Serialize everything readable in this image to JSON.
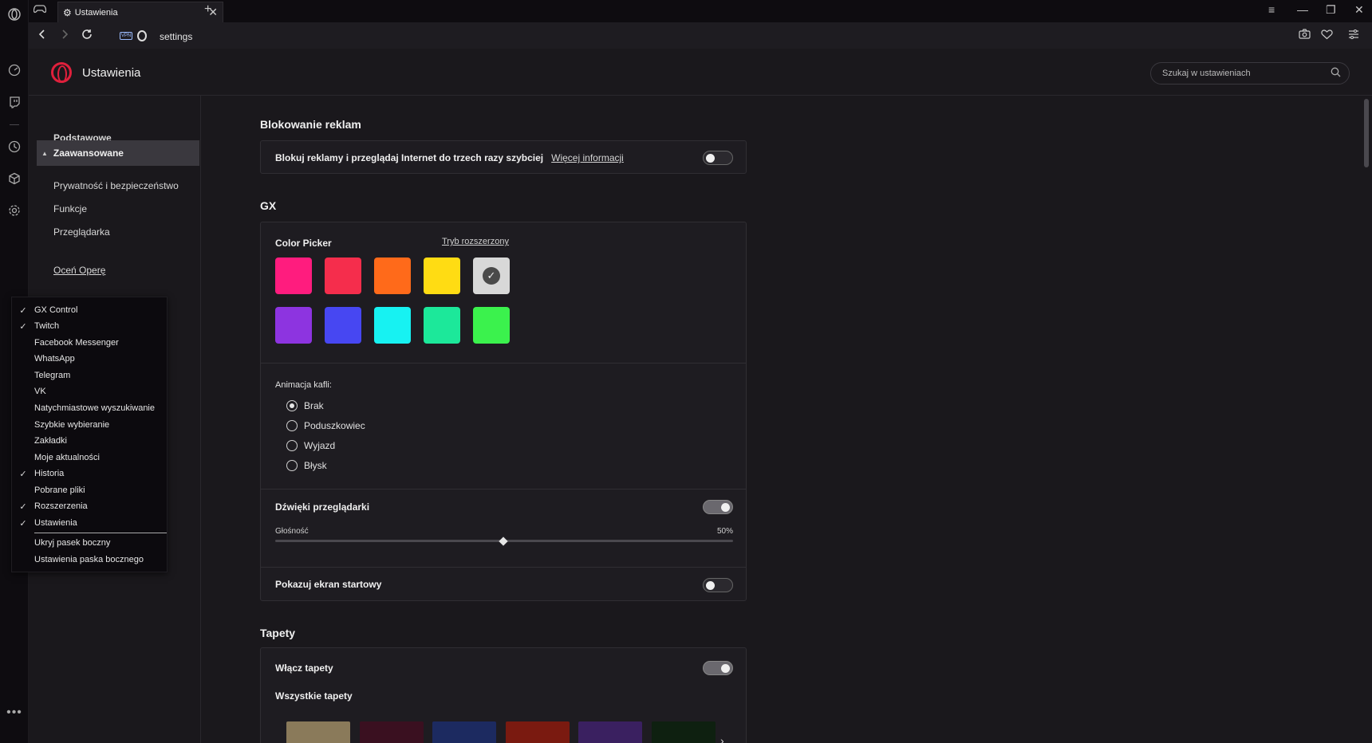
{
  "tab": {
    "title": "Ustawienia"
  },
  "address": {
    "url": "settings"
  },
  "header": {
    "title": "Ustawienia",
    "search_placeholder": "Szukaj w ustawieniach"
  },
  "nav": {
    "basic": "Podstawowe",
    "advanced": "Zaawansowane",
    "privacy": "Prywatność i bezpieczeństwo",
    "features": "Funkcje",
    "browser": "Przeglądarka",
    "rate": "Oceń Operę"
  },
  "adblock": {
    "title": "Blokowanie reklam",
    "label": "Blokuj reklamy i przeglądaj Internet do trzech razy szybciej",
    "link": "Więcej informacji",
    "enabled": false
  },
  "gx": {
    "title": "GX",
    "color_picker": "Color Picker",
    "extended_mode": "Tryb rozszerzony",
    "colors": [
      "#ff1c7e",
      "#f52d4c",
      "#ff6a1a",
      "#ffdc13",
      "#d8d8d8",
      "#8d34e0",
      "#4747f2",
      "#17f2f2",
      "#1ce89a",
      "#3bf24d"
    ],
    "selected_color_index": 4,
    "tile_anim_label": "Animacja kafli:",
    "tile_anim_options": [
      "Brak",
      "Poduszkowiec",
      "Wyjazd",
      "Błysk"
    ],
    "tile_anim_selected": 0,
    "sounds_label": "Dźwięki przeglądarki",
    "sounds_enabled": true,
    "volume_label": "Głośność",
    "volume_value": "50%",
    "startup_label": "Pokazuj ekran startowy",
    "startup_enabled": false
  },
  "wallpapers": {
    "title": "Tapety",
    "enable_label": "Włącz tapety",
    "enabled": true,
    "all_label": "Wszystkie tapety",
    "thumb_colors": [
      "#8a7a5a",
      "#3a1020",
      "#1c2a60",
      "#7a1a10",
      "#3a2060",
      "#0e2010"
    ]
  },
  "context_menu": {
    "items": [
      {
        "label": "GX Control",
        "checked": true
      },
      {
        "label": "Twitch",
        "checked": true
      },
      {
        "label": "Facebook Messenger",
        "checked": false
      },
      {
        "label": "WhatsApp",
        "checked": false
      },
      {
        "label": "Telegram",
        "checked": false
      },
      {
        "label": "VK",
        "checked": false
      },
      {
        "label": "Natychmiastowe wyszukiwanie",
        "checked": false
      },
      {
        "label": "Szybkie wybieranie",
        "checked": false
      },
      {
        "label": "Zakładki",
        "checked": false
      },
      {
        "label": "Moje aktualności",
        "checked": false
      },
      {
        "label": "Historia",
        "checked": true
      },
      {
        "label": "Pobrane pliki",
        "checked": false
      },
      {
        "label": "Rozszerzenia",
        "checked": true
      },
      {
        "label": "Ustawienia",
        "checked": true
      }
    ],
    "extra": [
      "Ukryj pasek boczny",
      "Ustawienia paska bocznego"
    ]
  }
}
